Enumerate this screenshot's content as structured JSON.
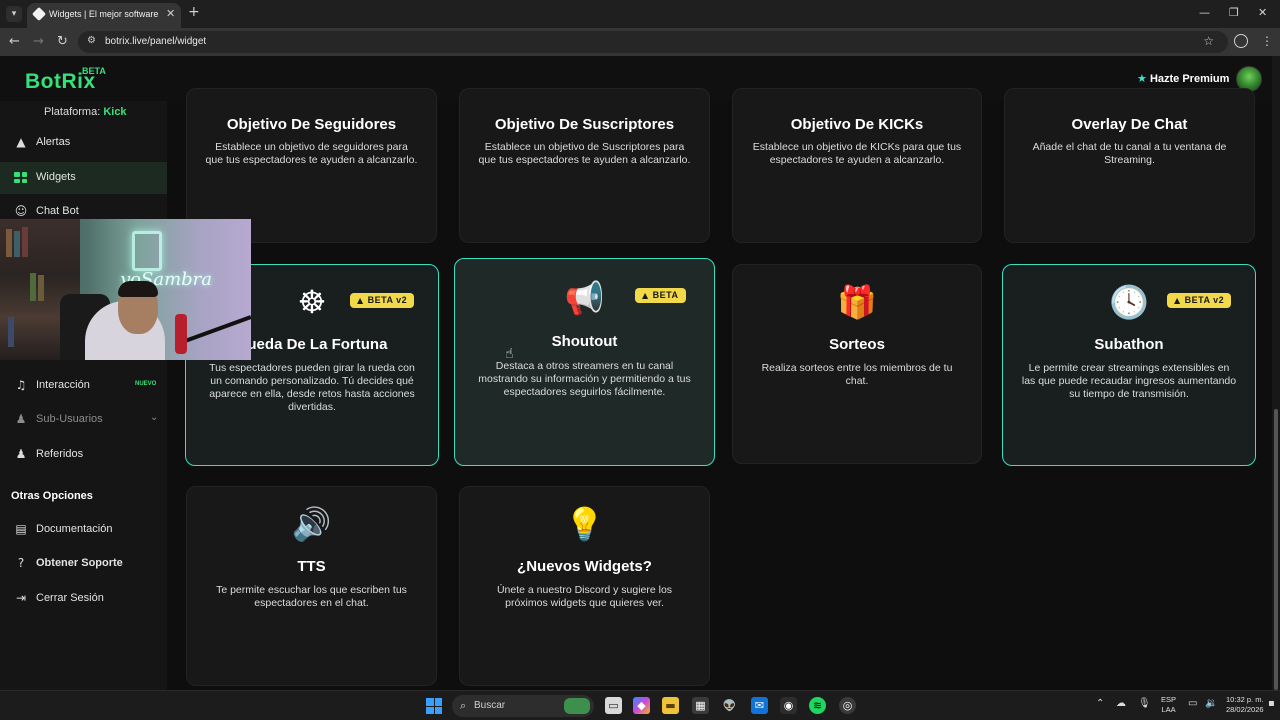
{
  "browser": {
    "tab_title": "Widgets | El mejor software pa",
    "url": "botrix.live/panel/widget"
  },
  "header": {
    "logo": "BotRix",
    "logo_badge": "BETA",
    "premium_label": "Hazte Premium"
  },
  "sidebar": {
    "platform_label": "Plataforma:",
    "platform_value": "Kick",
    "items": [
      {
        "label": "Alertas"
      },
      {
        "label": "Widgets"
      },
      {
        "label": "Chat Bot"
      },
      {
        "label": "Interacción",
        "badge": "NUEVO"
      },
      {
        "label": "Sub-Usuarios"
      },
      {
        "label": "Referidos"
      }
    ],
    "section_title": "Otras Opciones",
    "other_items": [
      {
        "label": "Documentación"
      },
      {
        "label": "Obtener Soporte"
      },
      {
        "label": "Cerrar Sesión"
      }
    ]
  },
  "webcam": {
    "neon_text": "yoSambra"
  },
  "widgets": [
    {
      "title": "Objetivo De Seguidores",
      "desc": "Establece un objetivo de seguidores para que tus espectadores te ayuden a alcanzarlo."
    },
    {
      "title": "Objetivo De Suscriptores",
      "desc": "Establece un objetivo de Suscriptores para que tus espectadores te ayuden a alcanzarlo."
    },
    {
      "title": "Objetivo De KICKs",
      "desc": "Establece un objetivo de KICKs para que tus espectadores te ayuden a alcanzarlo."
    },
    {
      "title": "Overlay De Chat",
      "desc": "Añade el chat de tu canal a tu ventana de Streaming."
    },
    {
      "title": "Rueda De La Fortuna",
      "desc": "Tus espectadores pueden girar la rueda con un comando personalizado. Tú decides qué aparece en ella, desde retos hasta acciones divertidas.",
      "badge": "BETA v2"
    },
    {
      "title": "Shoutout",
      "desc": "Destaca a otros streamers en tu canal mostrando su información y permitiendo a tus espectadores seguirlos fácilmente.",
      "badge": "BETA"
    },
    {
      "title": "Sorteos",
      "desc": "Realiza sorteos entre los miembros de tu chat."
    },
    {
      "title": "Subathon",
      "desc": "Le permite crear streamings extensibles en las que puede recaudar ingresos aumentando su tiempo de transmisión.",
      "badge": "BETA v2"
    },
    {
      "title": "TTS",
      "desc": "Te permite escuchar los que escriben tus espectadores en el chat."
    },
    {
      "title": "¿Nuevos Widgets?",
      "desc": "Únete a nuestro Discord y sugiere los próximos widgets que quieres ver."
    }
  ],
  "taskbar": {
    "search_placeholder": "Buscar",
    "lang_1": "ESP",
    "lang_2": "LAA",
    "time": "10:32 p. m.",
    "date": "28/02/2026"
  },
  "colors": {
    "accent": "#38e07a",
    "card_highlight": "#38e0c0",
    "beta_badge": "#f2d94a"
  }
}
